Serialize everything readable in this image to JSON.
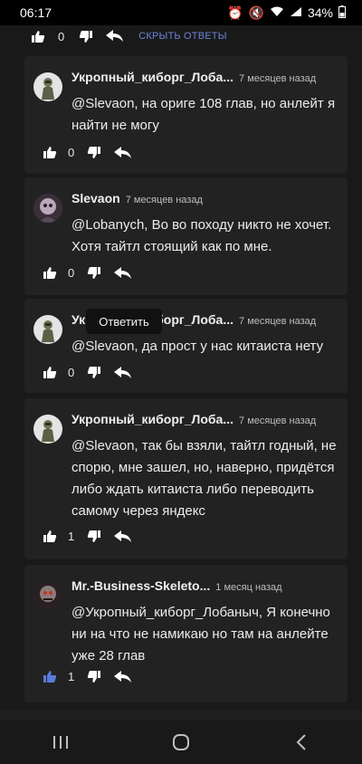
{
  "status_bar": {
    "time": "06:17",
    "battery": "34%"
  },
  "top_actions": {
    "like_count": "0",
    "hide_replies_label": "СКРЫТЬ ОТВЕТЫ"
  },
  "comments": [
    {
      "author": "Укропный_киборг_Лоба...",
      "date": "7 месяцев назад",
      "text": "@Slevaon, на ориге 108 глав, но анлейт я найти не могу",
      "likes": "0",
      "liked": false
    },
    {
      "author": "Slevaon",
      "date": "7 месяцев назад",
      "text": "@Lobanych, Во во походу никто не хочет. Хотя тайтл стоящий как по мне.",
      "likes": "0",
      "liked": false
    },
    {
      "author": "Укропный_киборг_Лоба...",
      "date": "7 месяцев назад",
      "text": "@Slevaon, да прост у нас китаиста нету",
      "likes": "0",
      "liked": false
    },
    {
      "author": "Укропный_киборг_Лоба...",
      "date": "7 месяцев назад",
      "text": "@Slevaon, так бы взяли, тайтл годный, не спорю, мне зашел, но, наверно, придётся либо ждать китаиста либо переводить самому через яндекс",
      "likes": "1",
      "liked": false
    },
    {
      "author": "Mr.-Business-Skeleto...",
      "date": "1 месяц назад",
      "text": "@Укропный_киборг_Лобаныч, Я конечно ни на что не намикаю но там на анлейте уже 28 глав",
      "likes": "1",
      "liked": true
    }
  ],
  "tooltip": "Ответить",
  "colors": {
    "background": "#191919",
    "card": "#222222",
    "accent": "#6b86d6",
    "liked": "#5a7bd6"
  }
}
